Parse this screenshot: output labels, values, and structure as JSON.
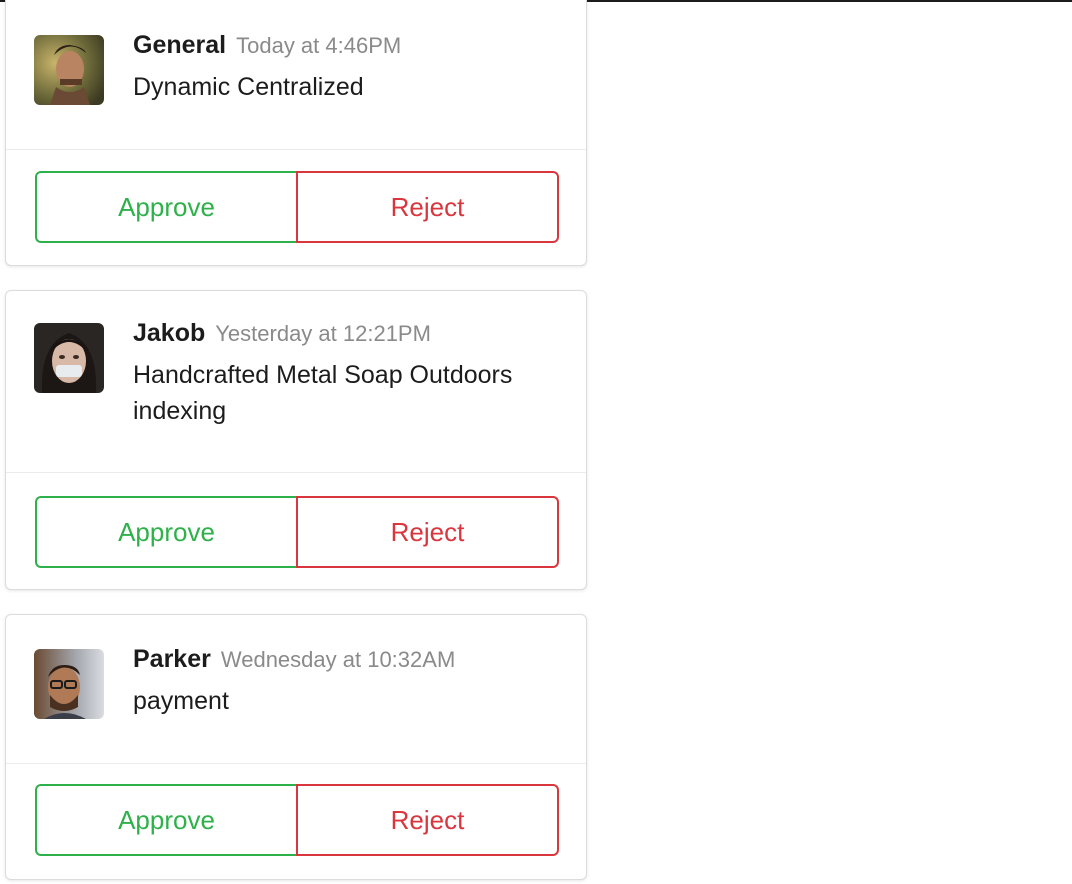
{
  "colors": {
    "approve": "#2eb14a",
    "reject": "#d9363e",
    "timestamp": "#8a8a8a",
    "text": "#1d1c1d"
  },
  "messages": [
    {
      "sender": "General",
      "timestamp": "Today at 4:46PM",
      "text": "Dynamic Centralized",
      "approve_label": "Approve",
      "reject_label": "Reject"
    },
    {
      "sender": "Jakob",
      "timestamp": "Yesterday at 12:21PM",
      "text": "Handcrafted Metal Soap Outdoors indexing",
      "approve_label": "Approve",
      "reject_label": "Reject"
    },
    {
      "sender": "Parker",
      "timestamp": "Wednesday at 10:32AM",
      "text": "payment",
      "approve_label": "Approve",
      "reject_label": "Reject"
    }
  ]
}
